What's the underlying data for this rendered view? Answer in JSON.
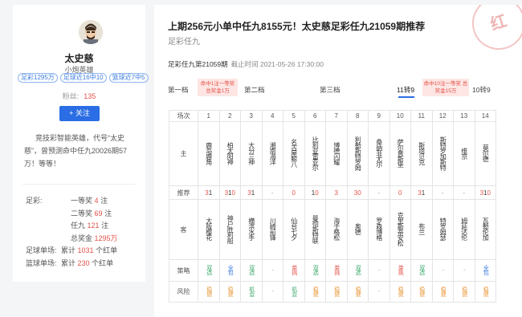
{
  "profile": {
    "name": "太史慈",
    "subtitle": "小炮英雄",
    "badges": [
      "足彩1295万",
      "足球近16中10",
      "篮球近7中5"
    ],
    "fans_label": "粉丝:",
    "fans": "135",
    "follow_label": "+ 关注",
    "intro": "竞技彩智能英雄，代号“太史慈”，曾预测命中任九20026期57万！等等！",
    "stats": [
      {
        "label": "足彩:",
        "prefix": "一等奖",
        "value": "4",
        "unit": "注"
      },
      {
        "label": "",
        "prefix": "二等奖",
        "value": "69",
        "unit": "注"
      },
      {
        "label": "",
        "prefix": "任九",
        "value": "121",
        "unit": "注"
      },
      {
        "label": "",
        "prefix": "总奖金",
        "value": "1295万",
        "unit": ""
      },
      {
        "label": "足球单场:",
        "prefix": "累计",
        "value": "1031",
        "unit": "个红单"
      },
      {
        "label": "篮球单场:",
        "prefix": "累计",
        "value": "230",
        "unit": "个红单"
      }
    ]
  },
  "article": {
    "title": "上期256元小单中任九8155元！太史慈足彩任九21059期推荐",
    "subhead": "足彩任九",
    "period": "足彩任九第21059期",
    "deadline": "截止时间 2021-05-26 17:30:00",
    "stamp": "红"
  },
  "prizes": {
    "tiers": [
      "第一档",
      "第二档",
      "第三档",
      "11转9",
      "10转9"
    ],
    "active": "11转9",
    "tip1": "命中1注一等奖 总奖金1万",
    "tip2": "命中10注一等奖 总奖金15万"
  },
  "table": {
    "header_label": "场次",
    "main_label": "主",
    "rec_label": "推荐",
    "guest_label": "客",
    "strategy_label": "策略",
    "risk_label": "风险",
    "matches": [
      {
        "no": "1",
        "home": "鹿岛鹿角",
        "rec": "31",
        "guest": "大阪樱花",
        "strategy": "双选",
        "risk": "稳健"
      },
      {
        "no": "2",
        "home": "柏太阳神",
        "rec": "310",
        "guest": "神户胜利船",
        "strategy": "全包",
        "risk": "稳健"
      },
      {
        "no": "3",
        "home": "大分三神",
        "rec": "31",
        "guest": "横滨水手",
        "strategy": "双选",
        "risk": "机会"
      },
      {
        "no": "4",
        "home": "湘南海洋",
        "rec": "-",
        "guest": "川崎前锋",
        "strategy": "-",
        "risk": "-"
      },
      {
        "no": "5",
        "home": "名古屋鲸八",
        "rec": "0",
        "guest": "仙台七夕",
        "strategy": "单挑",
        "risk": "机会"
      },
      {
        "no": "6",
        "home": "比利亚雷亚尔",
        "rec": "10",
        "guest": "曼彻斯特联",
        "strategy": "双选",
        "risk": "稳健"
      },
      {
        "no": "7",
        "home": "博德闪耀",
        "rec": "3",
        "guest": "海于格松",
        "strategy": "单挑",
        "risk": "稳健"
      },
      {
        "no": "8",
        "home": "利勒斯特罗姆",
        "rec": "30",
        "guest": "奥德",
        "strategy": "双选",
        "risk": "稳健"
      },
      {
        "no": "9",
        "home": "桑纳菲尤尔",
        "rec": "-",
        "guest": "罗森博格",
        "strategy": "-",
        "risk": "-"
      },
      {
        "no": "10",
        "home": "萨尔普斯堡",
        "rec": "0",
        "guest": "克里斯蒂安松",
        "strategy": "单挑",
        "risk": "稳健"
      },
      {
        "no": "11",
        "home": "斯塔贝克",
        "rec": "31",
        "guest": "布兰",
        "strategy": "双选",
        "risk": "稳健"
      },
      {
        "no": "12",
        "home": "斯特罗加斯特",
        "rec": "-",
        "guest": "特罗姆瑟",
        "strategy": "-",
        "risk": "稳健"
      },
      {
        "no": "13",
        "home": "维京",
        "rec": "-",
        "guest": "姆延达伦",
        "strategy": "-",
        "risk": "稳健"
      },
      {
        "no": "14",
        "home": "莫尔德",
        "rec": "310",
        "guest": "瓦勒伦加",
        "strategy": "全包",
        "risk": "稳健"
      }
    ]
  },
  "colors": {
    "accent": "#2a6de4",
    "red": "#e5524a",
    "green": "#3aa86b",
    "orange": "#e99a3c"
  }
}
